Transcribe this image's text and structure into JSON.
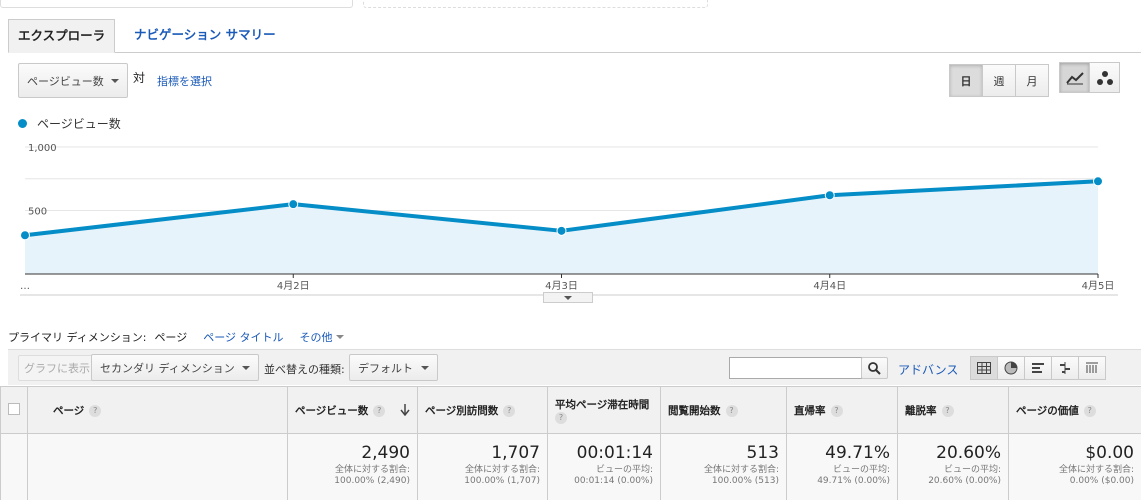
{
  "tabs": {
    "explorer": "エクスプローラ",
    "nav_summary": "ナビゲーション サマリー"
  },
  "controls": {
    "metric": "ページビュー数",
    "vs": "対",
    "pick_metric": "指標を選択",
    "periods": [
      "日",
      "週",
      "月"
    ],
    "selected_period": "日"
  },
  "legend": {
    "series": "ページビュー数",
    "color": "#058dc7"
  },
  "chart_data": {
    "type": "area",
    "x": [
      "…",
      "4月2日",
      "4月3日",
      "4月4日",
      "4月5日"
    ],
    "series": [
      {
        "name": "ページビュー数",
        "values": [
          305,
          550,
          340,
          620,
          730
        ]
      }
    ],
    "yticks": [
      "1,000",
      "500"
    ],
    "ylim": [
      0,
      1000
    ],
    "grid": true
  },
  "dimension": {
    "label": "プライマリ ディメンション:",
    "current": "ページ",
    "alt": "ページ タイトル",
    "more": "その他"
  },
  "toolbar": {
    "graph": "グラフに表示",
    "secondary": "セカンダリ ディメンション",
    "sort_label": "並べ替えの種類:",
    "sort_value": "デフォルト",
    "advanced": "アドバンス"
  },
  "table": {
    "headers": [
      "ページ",
      "ページビュー数",
      "ページ別訪問数",
      "平均ページ滞在時間",
      "閲覧開始数",
      "直帰率",
      "離脱率",
      "ページの価値"
    ],
    "totals": [
      {
        "value": "2,490",
        "sub1": "全体に対する割合:",
        "sub2": "100.00% (2,490)"
      },
      {
        "value": "1,707",
        "sub1": "全体に対する割合:",
        "sub2": "100.00% (1,707)"
      },
      {
        "value": "00:01:14",
        "sub1": "ビューの平均:",
        "sub2": "00:01:14 (0.00%)"
      },
      {
        "value": "513",
        "sub1": "全体に対する割合:",
        "sub2": "100.00% (513)"
      },
      {
        "value": "49.71%",
        "sub1": "ビューの平均:",
        "sub2": "49.71% (0.00%)"
      },
      {
        "value": "20.60%",
        "sub1": "ビューの平均:",
        "sub2": "20.60% (0.00%)"
      },
      {
        "value": "$0.00",
        "sub1": "全体に対する割合:",
        "sub2": "0.00% ($0.00)"
      }
    ]
  }
}
